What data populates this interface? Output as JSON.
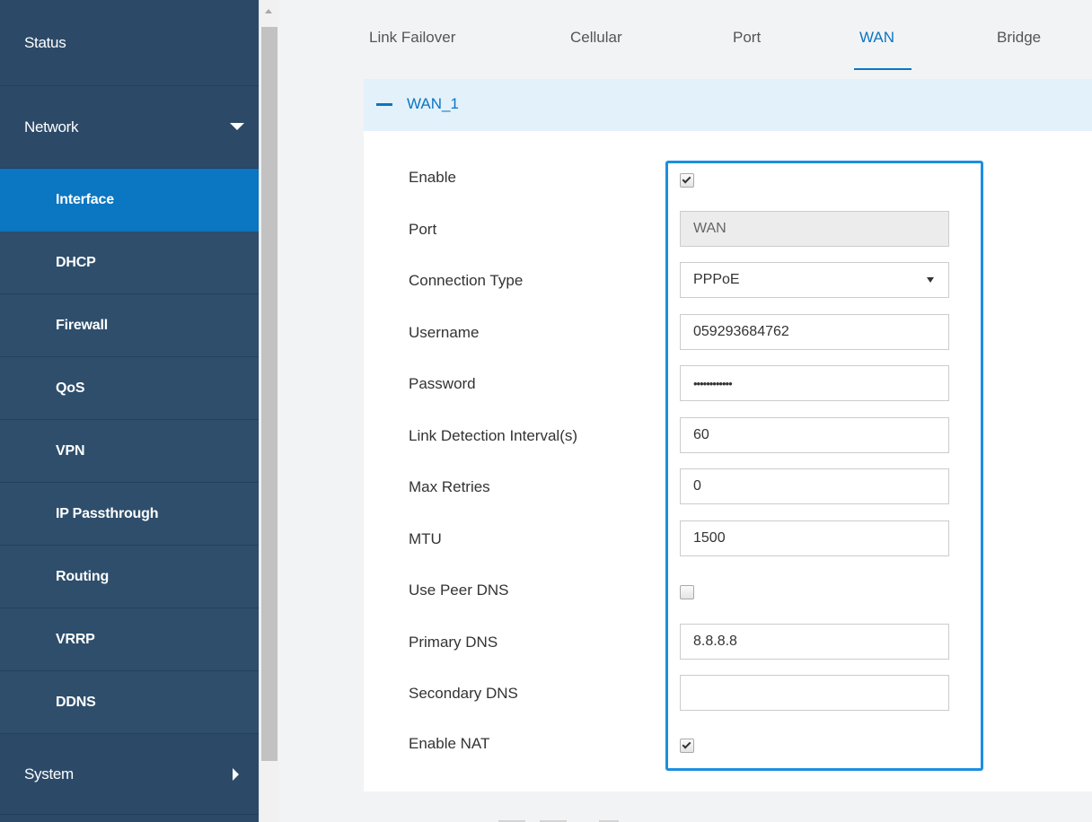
{
  "sidebar": {
    "items": [
      {
        "label": "Status"
      },
      {
        "label": "Network"
      },
      {
        "label": "Interface"
      },
      {
        "label": "DHCP"
      },
      {
        "label": "Firewall"
      },
      {
        "label": "QoS"
      },
      {
        "label": "VPN"
      },
      {
        "label": "IP Passthrough"
      },
      {
        "label": "Routing"
      },
      {
        "label": "VRRP"
      },
      {
        "label": "DDNS"
      },
      {
        "label": "System"
      }
    ],
    "active": "Interface"
  },
  "tabs": {
    "items": [
      {
        "label": "Link Failover"
      },
      {
        "label": "Cellular"
      },
      {
        "label": "Port"
      },
      {
        "label": "WAN"
      },
      {
        "label": "Bridge"
      }
    ],
    "active": "WAN"
  },
  "section": {
    "title": "WAN_1"
  },
  "form": {
    "enable": {
      "label": "Enable",
      "checked": true
    },
    "port": {
      "label": "Port",
      "value": "WAN"
    },
    "connection_type": {
      "label": "Connection Type",
      "value": "PPPoE"
    },
    "username": {
      "label": "Username",
      "value": "059293684762"
    },
    "password": {
      "label": "Password",
      "value": "••••••••••••"
    },
    "link_detection_interval": {
      "label": "Link Detection Interval(s)",
      "value": "60"
    },
    "max_retries": {
      "label": "Max Retries",
      "value": "0"
    },
    "mtu": {
      "label": "MTU",
      "value": "1500"
    },
    "use_peer_dns": {
      "label": "Use Peer DNS",
      "checked": false
    },
    "primary_dns": {
      "label": "Primary DNS",
      "value": "8.8.8.8"
    },
    "secondary_dns": {
      "label": "Secondary DNS",
      "value": ""
    },
    "enable_nat": {
      "label": "Enable NAT",
      "checked": true
    }
  },
  "colors": {
    "sidebar_bg": "#2c4a68",
    "active_blue": "#0b76c1",
    "highlight_border": "#1e8ee0",
    "section_header_bg": "#e3f1fb"
  },
  "icons": {
    "network_expand": "caret-down-icon",
    "system_expand": "caret-right-icon",
    "section_collapse": "minus-icon"
  }
}
